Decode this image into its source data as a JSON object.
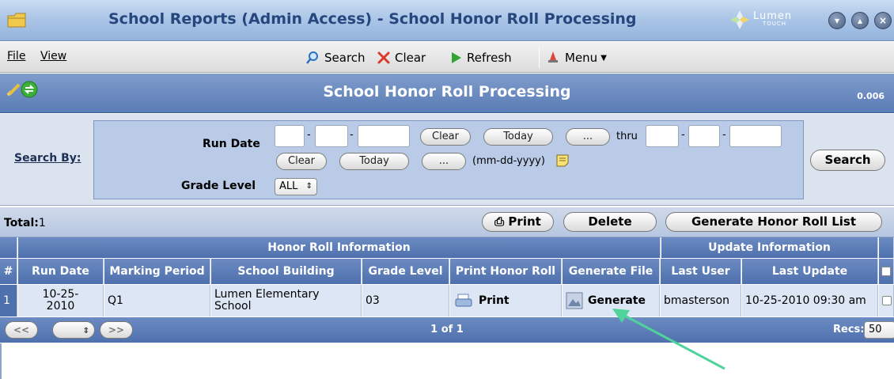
{
  "window": {
    "title": "School Reports (Admin Access) - School Honor Roll Processing",
    "logo_word": "Lumen",
    "logo_sub": "TOUCH"
  },
  "menubar": {
    "file": "File",
    "view": "View",
    "search": "Search",
    "clear": "Clear",
    "refresh": "Refresh",
    "menu": "Menu"
  },
  "page": {
    "title": "School Honor Roll Processing",
    "version": "0.006"
  },
  "search": {
    "search_by": "Search By:",
    "run_date_label": "Run Date",
    "grade_level_label": "Grade Level",
    "grade_level_value": "ALL",
    "clear": "Clear",
    "today": "Today",
    "ellipsis": "...",
    "thru": "thru",
    "format_hint": "(mm-dd-yyyy)",
    "search_button": "Search"
  },
  "actions": {
    "total_label": "Total:",
    "total_value": "1",
    "print": "Print",
    "delete": "Delete",
    "generate_list": "Generate Honor Roll List"
  },
  "table": {
    "group_headers": [
      "Honor Roll Information",
      "Update Information"
    ],
    "columns": [
      "#",
      "Run Date",
      "Marking Period",
      "School Building",
      "Grade Level",
      "Print Honor Roll",
      "Generate File",
      "Last User",
      "Last Update"
    ],
    "rows": [
      {
        "num": "1",
        "run_date": "10-25-2010",
        "marking_period": "Q1",
        "school_building": "Lumen Elementary School",
        "grade_level": "03",
        "print": "Print",
        "generate": "Generate",
        "last_user": "bmasterson",
        "last_update": "10-25-2010 09:30 am"
      }
    ]
  },
  "pager": {
    "prev": "<<",
    "next": ">>",
    "page_info": "1 of 1",
    "recs_label": "Recs:",
    "recs_value": "50"
  },
  "colors": {
    "header_blue": "#4e70ad",
    "title_text": "#25477e",
    "arrow_green": "#4fd39a"
  }
}
